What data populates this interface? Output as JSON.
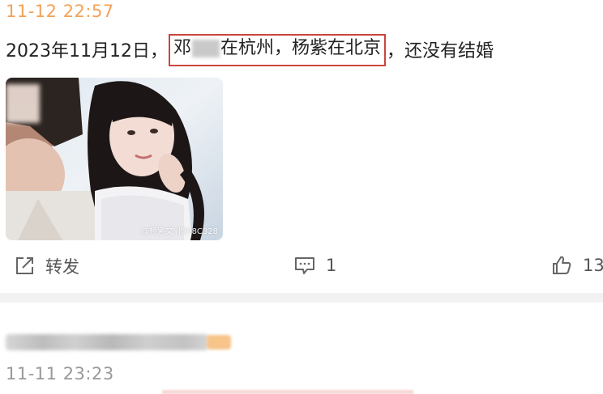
{
  "post1": {
    "timestamp": "11-12 22:57",
    "text_prefix": "2023年11月12日，",
    "highlight_name1_visible": "邓",
    "highlight_part1_rest": "在杭州，",
    "highlight_part2": "杨紫在北京",
    "text_suffix": "，还没有结婚",
    "image_watermark": "@杨紫文Y图98C328",
    "actions": {
      "repost_label": "转发",
      "comment_count": "1",
      "like_count": "13"
    }
  },
  "post2": {
    "timestamp": "11-11 23:23"
  },
  "colors": {
    "timestamp_orange": "#f4a157",
    "highlight_border": "#c9463d",
    "divider": "#f2f2f2",
    "muted_text": "#999999"
  },
  "icons": {
    "repost": "share-external-icon",
    "comment": "comment-bubble-icon",
    "like": "thumbs-up-icon"
  }
}
